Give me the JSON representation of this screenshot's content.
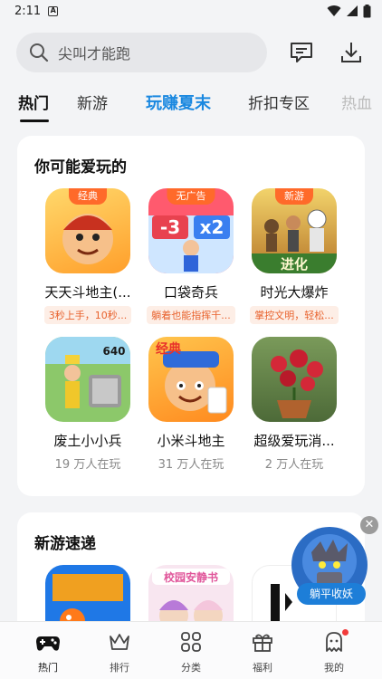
{
  "status_bar": {
    "time": "2:11",
    "notification_icon": "a-icon"
  },
  "search": {
    "placeholder": "尖叫才能跑"
  },
  "tabs": [
    {
      "label": "热门",
      "active": true
    },
    {
      "label": "新游"
    },
    {
      "label": "玩赚夏末",
      "promo": true
    },
    {
      "label": "折扣专区"
    },
    {
      "label": "热血"
    }
  ],
  "section_recommend": {
    "title": "你可能爱玩的",
    "apps": [
      {
        "name": "天天斗地主(...",
        "badge": "经典",
        "tag": "3秒上手，10秒...",
        "icon": "doudizhu-icon"
      },
      {
        "name": "口袋奇兵",
        "badge": "无广告",
        "tag": "躺着也能指挥千...",
        "icon": "pocket-army-icon"
      },
      {
        "name": "时光大爆炸",
        "badge": "新游",
        "tag": "掌控文明，轻松...",
        "icon": "evolution-icon",
        "icon_text": "进化"
      },
      {
        "name": "废土小小兵",
        "players": "19 万人在玩",
        "icon": "wasteland-icon",
        "icon_text": "640"
      },
      {
        "name": "小米斗地主",
        "players": "31 万人在玩",
        "icon": "mi-doudizhu-icon",
        "icon_text": "经典"
      },
      {
        "name": "超级爱玩消...",
        "players": "2 万人在玩",
        "icon": "rose-icon"
      }
    ]
  },
  "section_new": {
    "title": "新游速递",
    "apps": [
      {
        "icon": "fish-puzzle-icon"
      },
      {
        "icon": "campus-anime-icon",
        "icon_text": "校园安静书"
      },
      {
        "icon": "dark-maze-icon"
      }
    ]
  },
  "floating_ad": {
    "label": "躺平收妖"
  },
  "bottom_nav": [
    {
      "label": "热门",
      "icon": "gamepad-icon",
      "active": true
    },
    {
      "label": "排行",
      "icon": "crown-icon"
    },
    {
      "label": "分类",
      "icon": "grid-icon"
    },
    {
      "label": "福利",
      "icon": "gift-icon"
    },
    {
      "label": "我的",
      "icon": "ghost-icon",
      "dot": true
    }
  ],
  "colors": {
    "accent": "#1a88e0",
    "badge": "#ff6a2a",
    "tag_text": "#e8612c",
    "tag_bg": "#fdeee6"
  }
}
